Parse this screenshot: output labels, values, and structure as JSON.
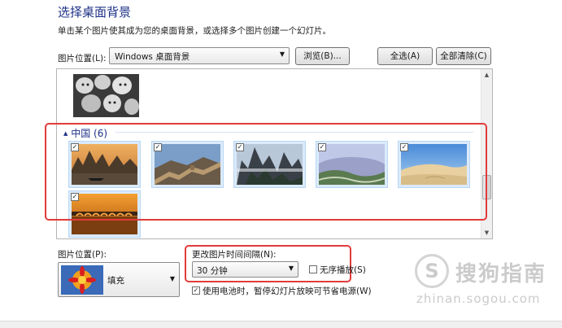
{
  "header": {
    "title": "选择桌面背景",
    "subtitle": "单击某个图片使其成为您的桌面背景，或选择多个图片创建一个幻灯片。"
  },
  "location": {
    "label": "图片位置(L):",
    "value": "Windows 桌面背景",
    "browse_label": "浏览(B)...",
    "select_all_label": "全选(A)",
    "clear_all_label": "全部清除(C)"
  },
  "gallery": {
    "group_name": "中国 (6)",
    "check_mark": "✓",
    "images": [
      {
        "name": "guilin-river",
        "checked": true
      },
      {
        "name": "great-wall",
        "checked": true
      },
      {
        "name": "huangshan-mountain",
        "checked": true
      },
      {
        "name": "terraced-fields",
        "checked": true
      },
      {
        "name": "desert-dunes",
        "checked": true
      },
      {
        "name": "seventeen-arch-bridge",
        "checked": true
      }
    ]
  },
  "position": {
    "label": "图片位置(P):",
    "value": "填充"
  },
  "interval": {
    "label": "更改图片时间间隔(N):",
    "value": "30 分钟",
    "shuffle_label": "无序播放(S)",
    "shuffle_checked": false,
    "battery_label": "使用电池时，暂停幻灯片放映可节省电源(W)",
    "battery_checked": true
  },
  "watermark": {
    "logo": "S",
    "text": "搜狗指南",
    "url": "zhinan.sogou.com"
  },
  "colors": {
    "title": "#1e3287",
    "highlight": "#e23b3b",
    "selection": "#dbeafb"
  }
}
